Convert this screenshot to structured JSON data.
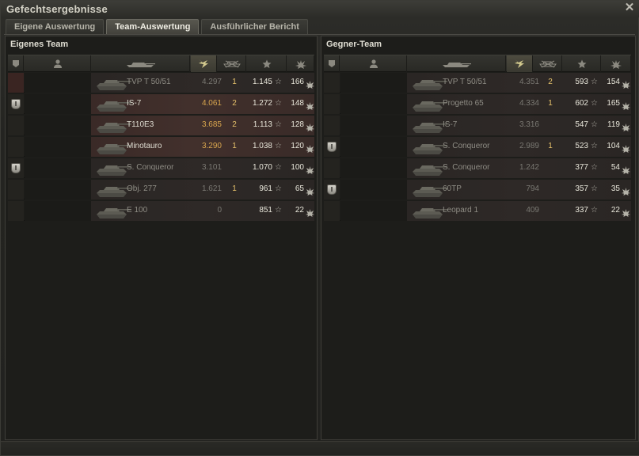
{
  "window": {
    "title": "Gefechtsergebnisse",
    "close_icon": "close-icon"
  },
  "tabs": [
    {
      "label": "Eigene Auswertung",
      "active": false
    },
    {
      "label": "Team-Auswertung",
      "active": true
    },
    {
      "label": "Ausführlicher Bericht",
      "active": false
    }
  ],
  "columns": [
    "platoon-icon",
    "player-icon",
    "tank-icon",
    "damage-icon",
    "kills-icon",
    "xp-icon",
    "rating-icon"
  ],
  "teams": [
    {
      "title": "Eigenes Team",
      "rows": [
        {
          "tank": "TVP T 50/51",
          "damage": "4.297",
          "kills": "1",
          "xp": "1.145",
          "rating": "166",
          "badge": false,
          "alive": false,
          "self": true
        },
        {
          "tank": "IS-7",
          "damage": "4.061",
          "kills": "2",
          "xp": "1.272",
          "rating": "148",
          "badge": true,
          "alive": true,
          "self": false
        },
        {
          "tank": "T110E3",
          "damage": "3.685",
          "kills": "2",
          "xp": "1.113",
          "rating": "128",
          "badge": false,
          "alive": true,
          "self": false
        },
        {
          "tank": "Minotauro",
          "damage": "3.290",
          "kills": "1",
          "xp": "1.038",
          "rating": "120",
          "badge": false,
          "alive": true,
          "self": false
        },
        {
          "tank": "S. Conqueror",
          "damage": "3.101",
          "kills": "",
          "xp": "1.070",
          "rating": "100",
          "badge": true,
          "alive": false,
          "self": false
        },
        {
          "tank": "Obj. 277",
          "damage": "1.621",
          "kills": "1",
          "xp": "961",
          "rating": "65",
          "badge": false,
          "alive": false,
          "self": false
        },
        {
          "tank": "E 100",
          "damage": "0",
          "kills": "",
          "xp": "851",
          "rating": "22",
          "badge": false,
          "alive": false,
          "self": false
        }
      ]
    },
    {
      "title": "Gegner-Team",
      "rows": [
        {
          "tank": "TVP T 50/51",
          "damage": "4.351",
          "kills": "2",
          "xp": "593",
          "rating": "154",
          "badge": false,
          "alive": false,
          "self": false
        },
        {
          "tank": "Progetto 65",
          "damage": "4.334",
          "kills": "1",
          "xp": "602",
          "rating": "165",
          "badge": false,
          "alive": false,
          "self": false
        },
        {
          "tank": "IS-7",
          "damage": "3.316",
          "kills": "",
          "xp": "547",
          "rating": "119",
          "badge": false,
          "alive": false,
          "self": false
        },
        {
          "tank": "S. Conqueror",
          "damage": "2.989",
          "kills": "1",
          "xp": "523",
          "rating": "104",
          "badge": true,
          "alive": false,
          "self": false
        },
        {
          "tank": "S. Conqueror",
          "damage": "1.242",
          "kills": "",
          "xp": "377",
          "rating": "54",
          "badge": false,
          "alive": false,
          "self": false
        },
        {
          "tank": "60TP",
          "damage": "794",
          "kills": "",
          "xp": "357",
          "rating": "35",
          "badge": true,
          "alive": false,
          "self": false
        },
        {
          "tank": "Leopard 1",
          "damage": "409",
          "kills": "",
          "xp": "337",
          "rating": "22",
          "badge": false,
          "alive": false,
          "self": false
        }
      ]
    }
  ],
  "colors": {
    "damage": "#d8a54e",
    "kills": "#e5c16a",
    "row_bg": "#42302c",
    "accent": "#d2c98e"
  }
}
